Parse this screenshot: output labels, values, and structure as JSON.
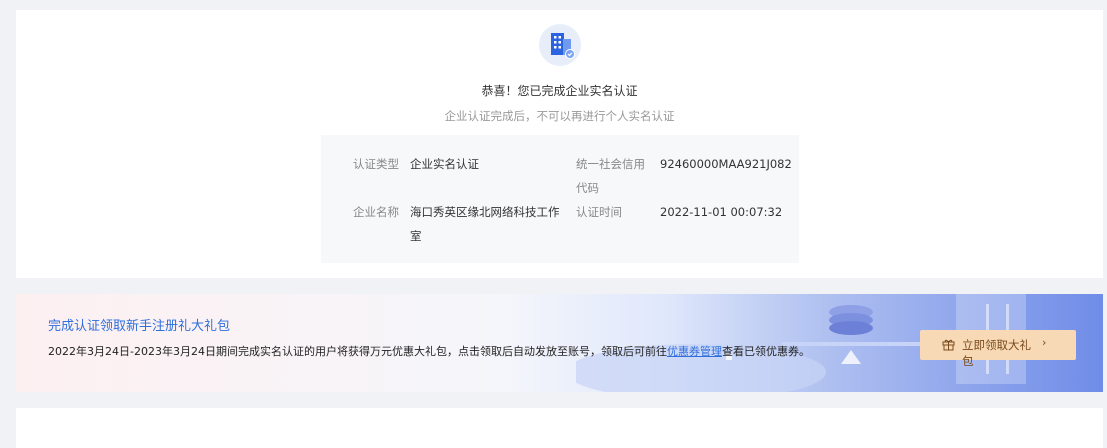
{
  "verification": {
    "title": "恭喜！您已完成企业实名认证",
    "subtitle": "企业认证完成后，不可以再进行个人实名认证",
    "fields": {
      "type_label": "认证类型",
      "type_value": "企业实名认证",
      "credit_code_label_line1": "统一社会信用",
      "credit_code_label_line2": "代码",
      "credit_code_value": "92460000MAA921J082",
      "company_label": "企业名称",
      "company_value_line1": "海口秀英区缘北网络科技工作",
      "company_value_line2": "室",
      "time_label": "认证时间",
      "time_value": "2022-11-01 00:07:32"
    }
  },
  "promo": {
    "title": "完成认证领取新手注册礼大礼包",
    "desc_before": "2022年3月24日-2023年3月24日期间完成实名认证的用户将获得万元优惠大礼包，点击领取后自动发放至账号，领取后可前往",
    "desc_link": "优惠券管理",
    "desc_after": "查看已领优惠券。",
    "button_label": "立即领取大礼包",
    "button_chevron": "›"
  },
  "icons": {
    "hero": "enterprise-building-verified-icon",
    "gift": "gift-icon"
  },
  "colors": {
    "accent": "#2f6fdc",
    "button_bg": "#f7d9b5"
  }
}
